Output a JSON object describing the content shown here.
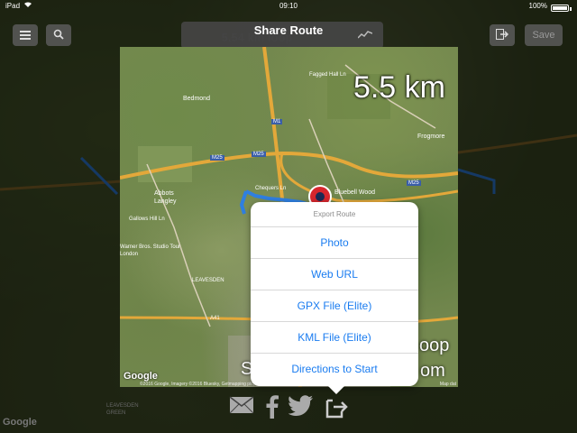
{
  "status_bar": {
    "device": "iPad",
    "time": "09:10",
    "battery": "100%"
  },
  "toolbar": {
    "behind_title": "5.54 km loop",
    "share_title": "Share Route",
    "save_label": "Save"
  },
  "preview": {
    "distance": "5.5 km",
    "google": "Google",
    "copyright": "©2016 Google, Imagery ©2016 Bluesky, Getmapping plc, Infoterra Ltd & Bluesky,",
    "copyright_right": "Map dat",
    "places": [
      "Bedmond",
      "Abbots Langley",
      "Warner Bros. Studio Tour London",
      "LEAVESDEN",
      "Chequers Ln",
      "Bluebell Wood",
      "Frogmore",
      "M1",
      "M25",
      "A41",
      "Fagged Hall Ln",
      "Gallows Hill Ln"
    ],
    "watermark_1": "oop",
    "watermark_2": "S",
    "watermark_3": "om"
  },
  "background": {
    "google": "Google",
    "place": "LEAVESDEN GREEN"
  },
  "export_menu": {
    "header": "Export Route",
    "items": [
      "Photo",
      "Web URL",
      "GPX File (Elite)",
      "KML File (Elite)",
      "Directions to Start"
    ]
  },
  "colors": {
    "accent": "#1a7cf0",
    "route": "#2f7fe0",
    "road_motorway": "#e3a83a"
  },
  "share_icons": [
    "mail-icon",
    "facebook-icon",
    "twitter-icon",
    "export-icon"
  ]
}
